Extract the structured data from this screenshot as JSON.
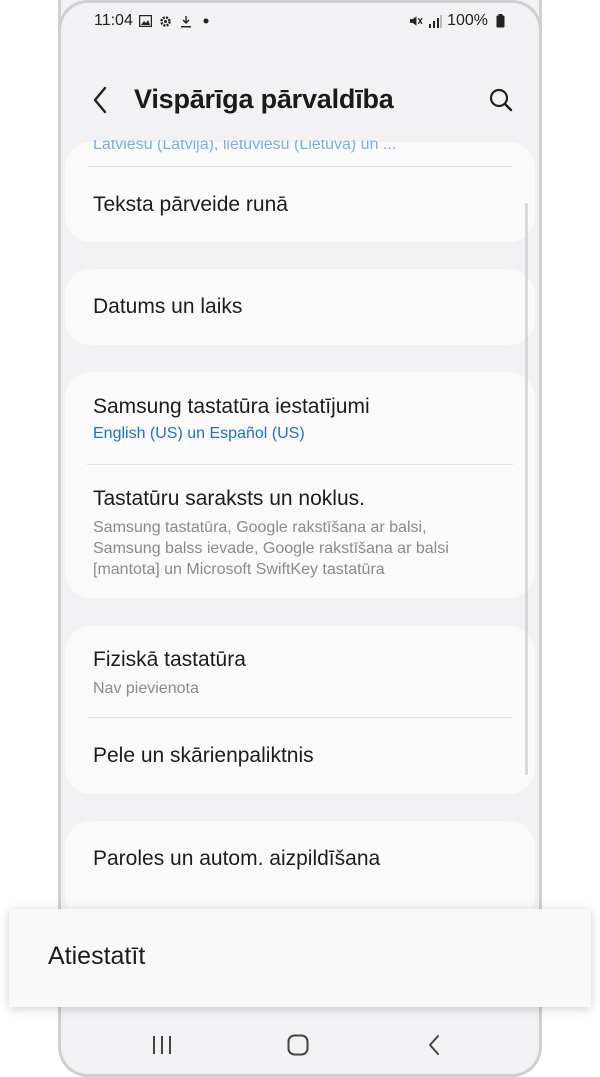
{
  "status_bar": {
    "time": "11:04",
    "left_icons": [
      "image-icon",
      "gear-icon",
      "download-icon",
      "dot-icon"
    ],
    "right_icons": [
      "mute-icon",
      "signal-icon"
    ],
    "battery": "100%"
  },
  "header": {
    "title": "Vispārīga pārvaldība",
    "back_icon": "chevron-left-icon",
    "search_icon": "search-icon"
  },
  "partial_top_text": "Latviešu (Latvija), lietuviešu (Lietuva) un ...",
  "items": [
    {
      "title": "Teksta pārveide runā"
    },
    {
      "title": "Datums un laiks"
    },
    {
      "title": "Samsung tastatūra iestatījumi",
      "subtitle": "English (US) un Español (US)"
    },
    {
      "title": "Tastatūru saraksts un noklus.",
      "subtitle_lines": [
        "Samsung tastatūra, Google rakstīšana ar balsi,",
        "Samsung balss ievade, Google rakstīšana ar balsi",
        "[mantota] un Microsoft SwiftKey tastatūra"
      ]
    },
    {
      "title": "Fiziskā tastatūra",
      "subtitle": "Nav pievienota"
    },
    {
      "title": "Pele un skārienpaliktnis"
    },
    {
      "title": "Paroles un autom. aizpildīšana"
    }
  ],
  "popup": {
    "label": "Atiestatīt"
  },
  "nav_bar": {
    "icons": [
      "recent-apps-icon",
      "home-icon",
      "back-icon"
    ]
  },
  "colors": {
    "background": "#f2f2f4",
    "card": "#fafafa",
    "accent_blue": "#1f6fc8",
    "secondary_text": "#8a8a8a"
  }
}
